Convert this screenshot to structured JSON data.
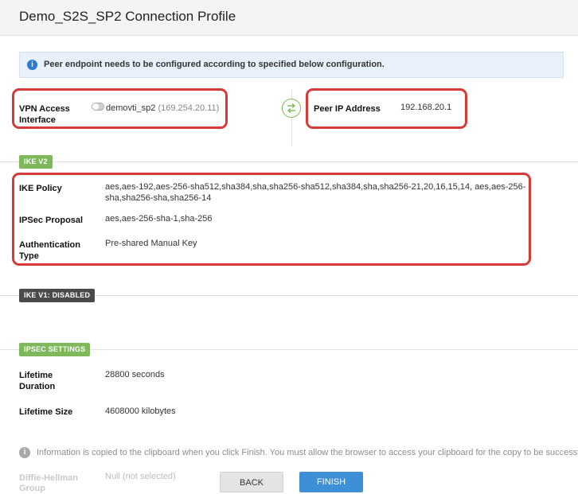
{
  "header": {
    "title": "Demo_S2S_SP2 Connection Profile"
  },
  "info_banner": {
    "text": "Peer endpoint needs to be configured according to specified below configuration."
  },
  "vpn_access": {
    "label_line1": "VPN Access",
    "label_line2": "Interface",
    "interface_name": "demovti_sp2",
    "interface_ip": "(169.254.20.11)"
  },
  "peer": {
    "label": "Peer IP Address",
    "value": "192.168.20.1"
  },
  "ikev2": {
    "tag": "IKE V2",
    "policy_label": "IKE Policy",
    "policy_line1": "aes,aes-192,aes-256-sha512,sha384,sha,sha256-sha512,sha384,sha,sha256-21,20,16,15,14, aes,aes-256-",
    "policy_line2": "sha,sha256-sha,sha256-14",
    "proposal_label": "IPSec Proposal",
    "proposal_value": "aes,aes-256-sha-1,sha-256",
    "auth_label_line1": "Authentication",
    "auth_label_line2": "Type",
    "auth_value": "Pre-shared Manual Key"
  },
  "ikev1": {
    "tag": "IKE V1: DISABLED"
  },
  "ipsec": {
    "tag": "IPSEC SETTINGS",
    "lifetime_duration_label_line1": "Lifetime",
    "lifetime_duration_label_line2": "Duration",
    "lifetime_duration_value": "28800 seconds",
    "lifetime_size_label": "Lifetime Size",
    "lifetime_size_value": "4608000 kilobytes",
    "dh_label_line1": "Diffie-Hellman",
    "dh_label_line2": "Group",
    "dh_value": "Null (not selected)"
  },
  "footer": {
    "info_text": "Information is copied to the clipboard when you click Finish. You must allow the browser to access your clipboard for the copy to be successful.",
    "back_label": "BACK",
    "finish_label": "FINISH"
  },
  "colors": {
    "highlight_red": "#d83a3a",
    "tag_green": "#7fb85a",
    "tag_dark": "#4a4a4a",
    "finish_blue": "#3f8fd6"
  }
}
